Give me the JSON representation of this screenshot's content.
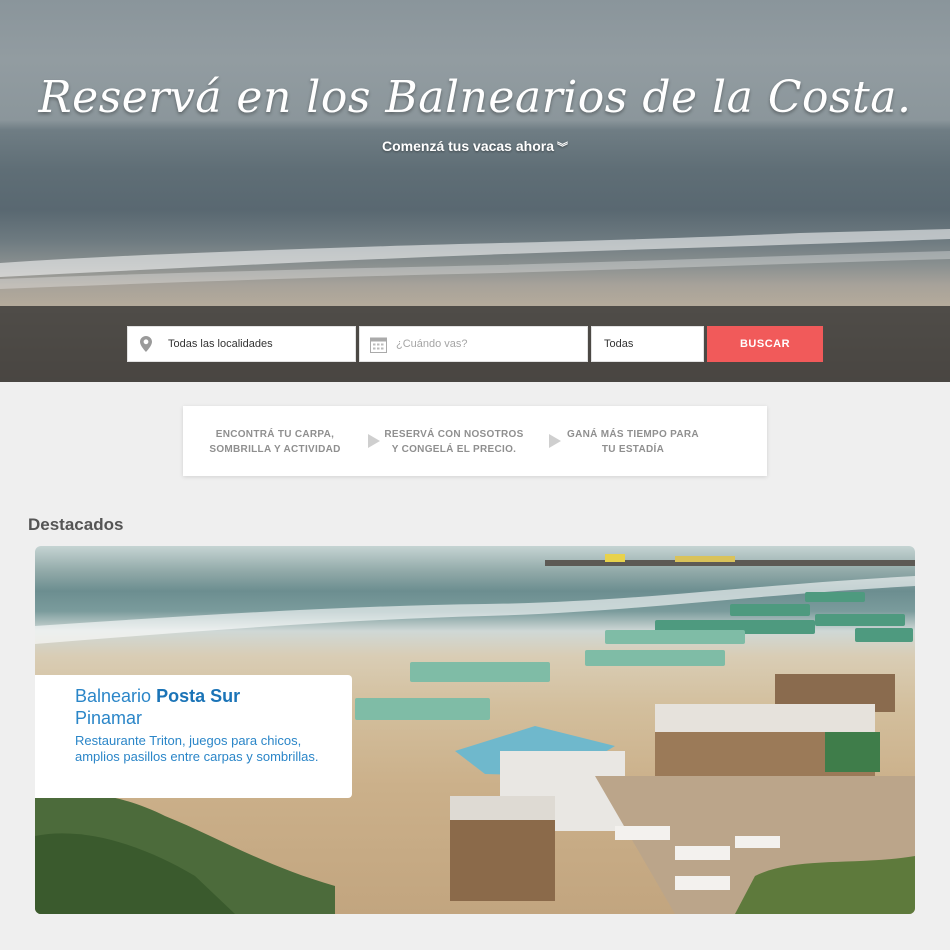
{
  "hero": {
    "title": "Reservá en los Balnearios de la Costa.",
    "subtitle": "Comenzá tus vacas ahora",
    "subtitle_icon": "double-chevron-down-icon"
  },
  "search": {
    "location_value": "Todas las localidades",
    "location_icon": "map-pin-icon",
    "date_placeholder": "¿Cuándo vas?",
    "date_icon": "calendar-icon",
    "type_value": "Todas",
    "button_label": "BUSCAR",
    "button_color": "#f15a5a"
  },
  "steps": [
    {
      "line1": "ENCONTRÁ TU CARPA,",
      "line2": "SOMBRILLA Y ACTIVIDAD"
    },
    {
      "line1": "RESERVÁ CON NOSOTROS",
      "line2": "Y CONGELÁ EL PRECIO."
    },
    {
      "line1": "GANÁ MÁS TIEMPO PARA",
      "line2": "TU ESTADÍA"
    }
  ],
  "featured": {
    "section_title": "Destacados",
    "card": {
      "name_prefix": "Balneario",
      "name_bold": "Posta Sur",
      "city": "Pinamar",
      "description": "Restaurante Triton, juegos para chicos, amplios pasillos entre carpas y sombrillas.",
      "text_color": "#2b86c8"
    }
  }
}
